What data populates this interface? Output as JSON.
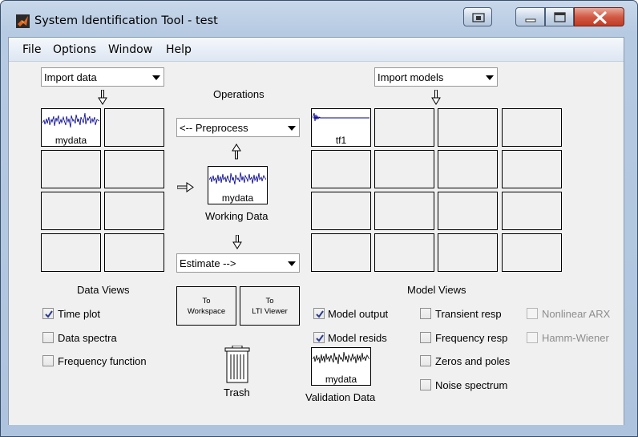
{
  "window": {
    "title": "System Identification Tool - test",
    "controls": {
      "extra_icon": "window-switch-icon",
      "minimize_icon": "minimize-icon",
      "maximize_icon": "maximize-icon",
      "close_icon": "close-icon"
    }
  },
  "menu": {
    "file": "File",
    "options": "Options",
    "window": "Window",
    "help": "Help"
  },
  "data_side": {
    "import_combo": "Import data",
    "slots": [
      {
        "label": "mydata",
        "filled": true
      },
      {
        "label": "",
        "filled": false
      },
      {
        "label": "",
        "filled": false
      },
      {
        "label": "",
        "filled": false
      },
      {
        "label": "",
        "filled": false
      },
      {
        "label": "",
        "filled": false
      },
      {
        "label": "",
        "filled": false
      },
      {
        "label": "",
        "filled": false
      }
    ],
    "views_title": "Data Views",
    "views": [
      {
        "label": "Time plot",
        "checked": true
      },
      {
        "label": "Data spectra",
        "checked": false
      },
      {
        "label": "Frequency function",
        "checked": false
      }
    ]
  },
  "operations": {
    "title": "Operations",
    "preprocess_combo": "<-- Preprocess",
    "working_data_label": "mydata",
    "working_data_caption": "Working Data",
    "estimate_combo": "Estimate -->",
    "to_workspace": {
      "line1": "To",
      "line2": "Workspace"
    },
    "to_lti_viewer": {
      "line1": "To",
      "line2": "LTI Viewer"
    },
    "trash_label": "Trash"
  },
  "model_side": {
    "import_combo": "Import models",
    "first_slot_label": "tf1",
    "views_title": "Model Views",
    "views_col1": [
      {
        "label": "Model output",
        "checked": true
      },
      {
        "label": "Model resids",
        "checked": true
      }
    ],
    "views_col2": [
      {
        "label": "Transient resp",
        "checked": false
      },
      {
        "label": "Frequency resp",
        "checked": false
      },
      {
        "label": "Zeros and poles",
        "checked": false
      },
      {
        "label": "Noise spectrum",
        "checked": false
      }
    ],
    "views_col3": [
      {
        "label": "Nonlinear ARX",
        "checked": false,
        "disabled": true
      },
      {
        "label": "Hamm-Wiener",
        "checked": false,
        "disabled": true
      }
    ],
    "validation_data_label": "mydata",
    "validation_data_caption": "Validation Data"
  },
  "colors": {
    "signal": "#00008b",
    "accent_title": "#c9d8ea"
  }
}
